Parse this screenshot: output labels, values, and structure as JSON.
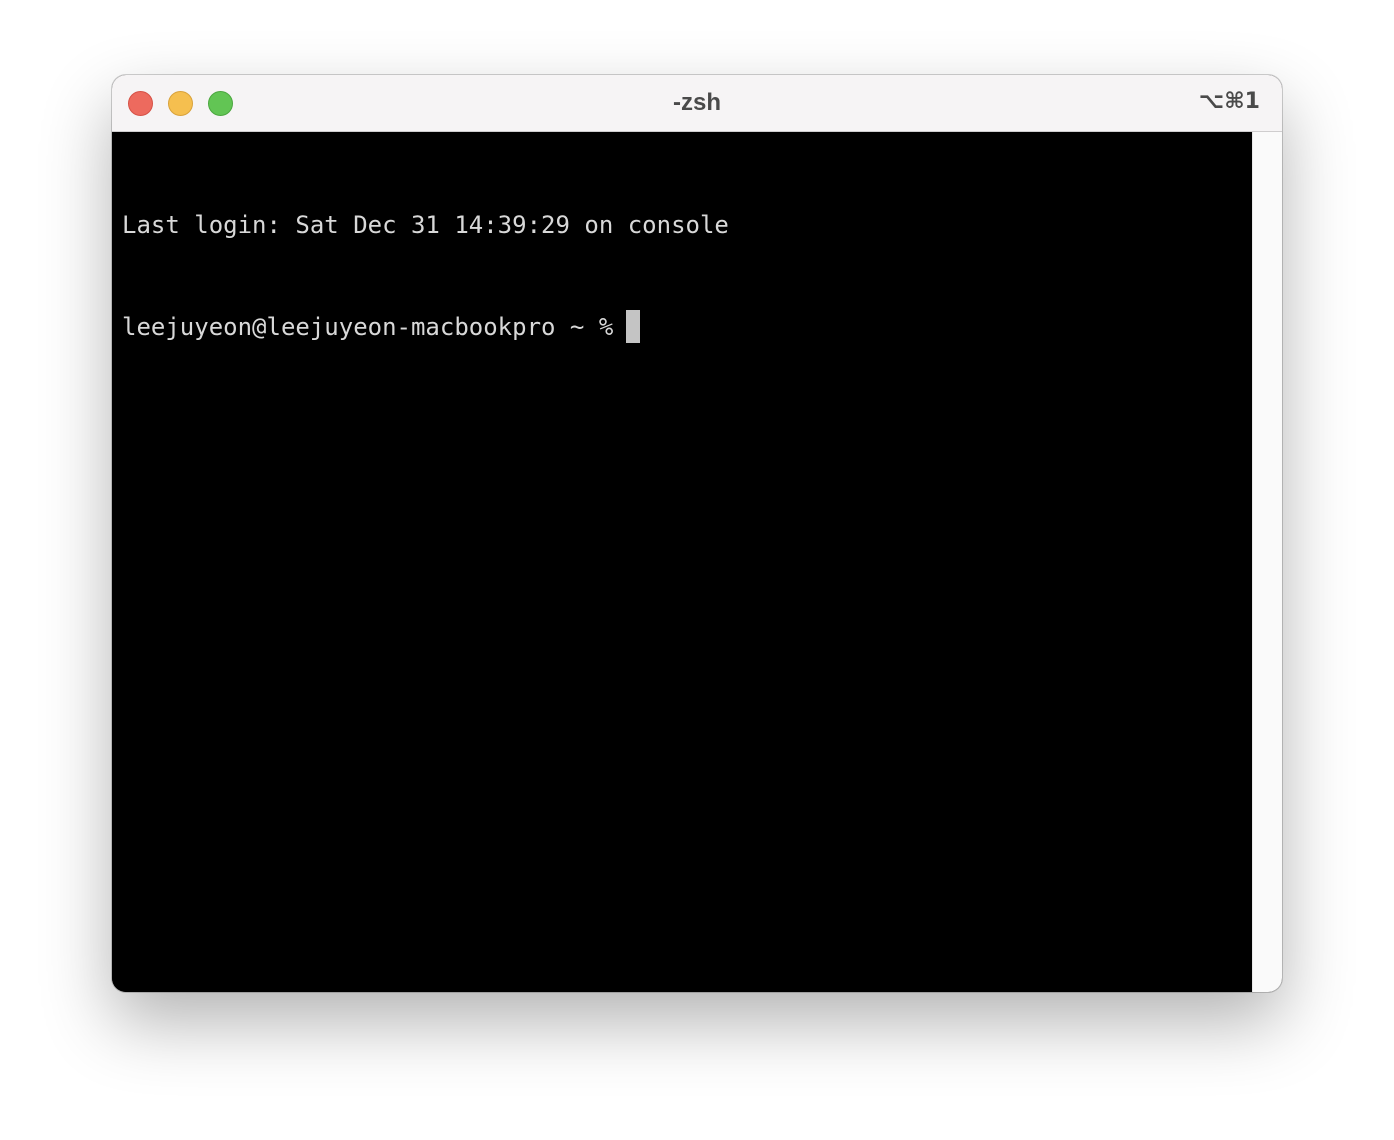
{
  "window": {
    "title": "-zsh",
    "shortcut": "⌥⌘1"
  },
  "terminal": {
    "lines": [
      "Last login: Sat Dec 31 14:39:29 on console"
    ],
    "prompt": "leejuyeon@leejuyeon-macbookpro ~ %"
  },
  "colors": {
    "close": "#ed6a5e",
    "minimize": "#f5bf4f",
    "zoom": "#62c554",
    "terminal_background": "#000000",
    "terminal_text": "#d8d8d8"
  }
}
